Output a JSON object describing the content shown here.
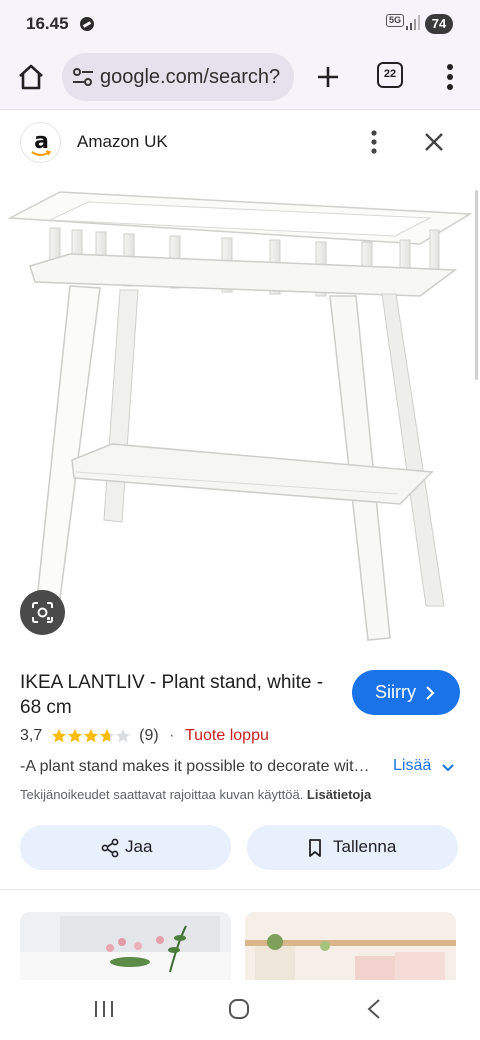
{
  "status_bar": {
    "time": "16.45",
    "network": "5G",
    "battery": "74"
  },
  "browser": {
    "url": "google.com/search?",
    "tab_count": "22",
    "icons": [
      "home-icon",
      "tune-icon",
      "plus-icon",
      "tabs-icon",
      "more-vert-icon"
    ]
  },
  "source": {
    "name": "Amazon UK",
    "logo_letter": "a",
    "icons": [
      "more-vert-icon",
      "close-icon"
    ]
  },
  "product": {
    "title": "IKEA LANTLIV - Plant stand, white - 68 cm",
    "visit_label": "Siirry",
    "rating_value": "3,7",
    "rating": 3.7,
    "rating_max": 5,
    "review_count": "(9)",
    "separator": "·",
    "stock_status": "Tuote loppu",
    "description": "-A plant stand makes it possible to decorate with plants in all rooms of the house.",
    "more_label": "Lisää",
    "copyright_notice": "Tekijänoikeudet saattavat rajoittaa kuvan käyttöä.",
    "copyright_link": "Lisätietoja"
  },
  "actions": {
    "share_label": "Jaa",
    "save_label": "Tallenna"
  },
  "colors": {
    "accent": "#1a73e8",
    "star": "#fbbc04",
    "out_of_stock": "#c5221f",
    "pill_bg": "#e8f0fe",
    "chrome_bg": "#f6f3fb"
  }
}
